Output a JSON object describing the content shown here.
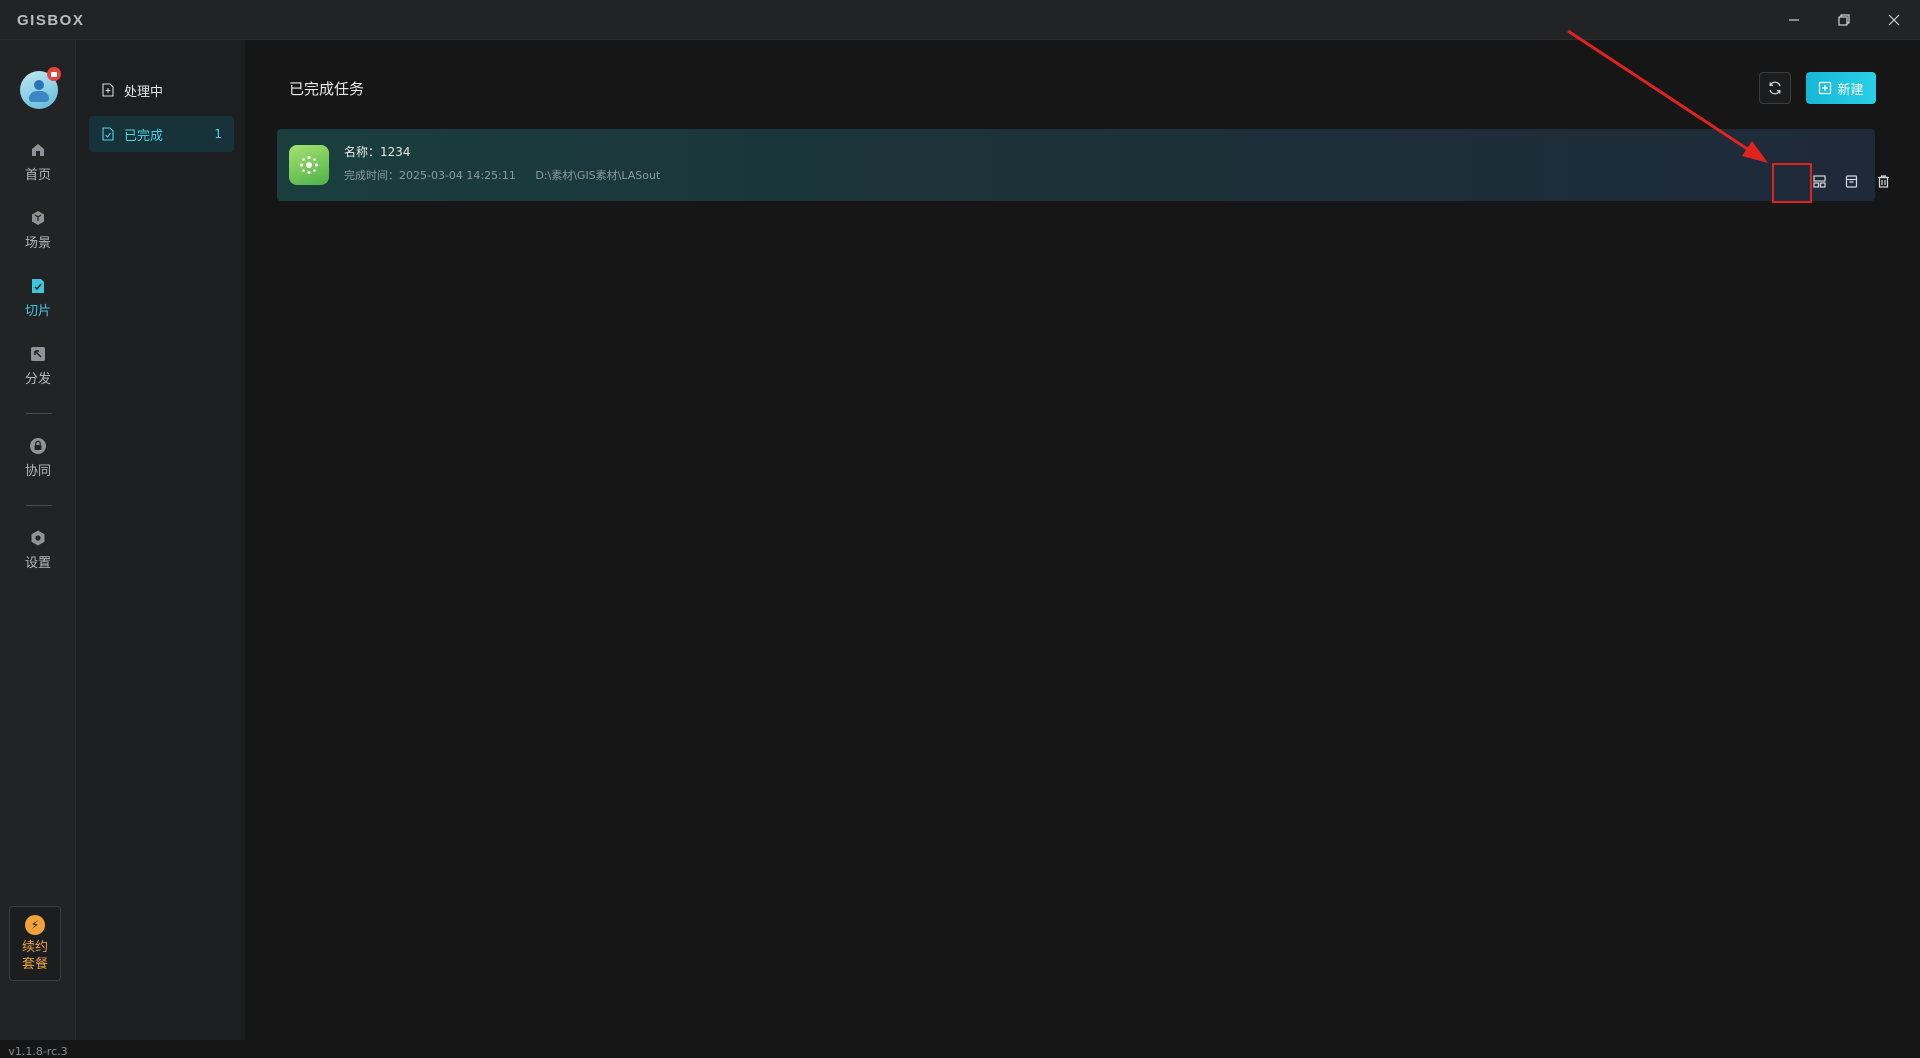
{
  "app": {
    "logo": "GISBOX",
    "version": "v1.1.8-rc.3"
  },
  "rail": {
    "items": [
      {
        "label": "首页",
        "icon": "home-icon"
      },
      {
        "label": "场景",
        "icon": "cube-icon"
      },
      {
        "label": "切片",
        "icon": "slice-icon",
        "active": true
      },
      {
        "label": "分发",
        "icon": "distribute-icon"
      },
      {
        "label": "协同",
        "icon": "lock-icon"
      },
      {
        "label": "设置",
        "icon": "gear-icon"
      }
    ],
    "renew_label_1": "续约",
    "renew_label_2": "套餐"
  },
  "subnav": {
    "items": [
      {
        "label": "处理中"
      },
      {
        "label": "已完成",
        "count": "1",
        "active": true
      }
    ]
  },
  "main": {
    "title": "已完成任务",
    "new_button": "新建",
    "tasks": [
      {
        "name": "名称：1234",
        "completed": "完成时间：2025-03-04 14:25:11",
        "path": "D:\\素材\\GIS素材\\LASout"
      }
    ]
  },
  "colors": {
    "accent": "#2ad0e6",
    "annotation": "#e0231f",
    "renew": "#f0a23b"
  }
}
